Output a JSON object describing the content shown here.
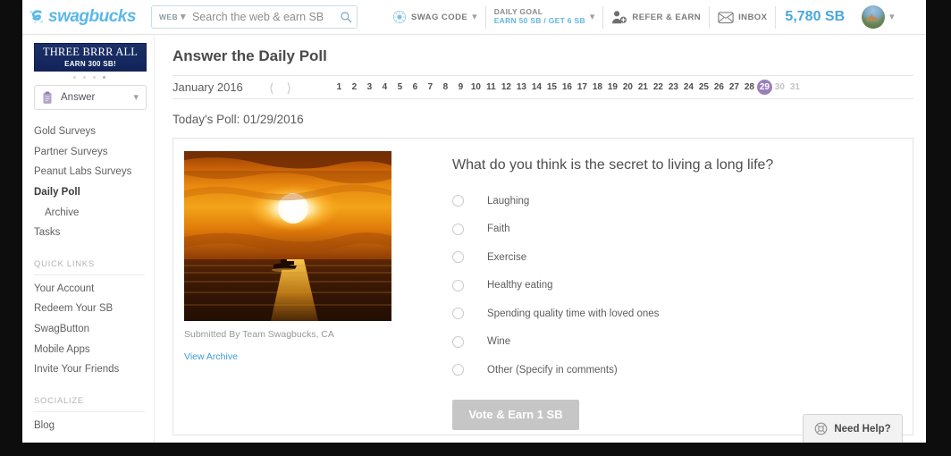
{
  "header": {
    "logo_text": "swagbucks",
    "logo_icon": "swagbucks-snowflake-logo",
    "search": {
      "vertical_label": "WEB",
      "placeholder": "Search the web & earn SB",
      "value": "",
      "icon": "search-icon"
    },
    "swag_code": {
      "label": "SWAG CODE",
      "icon": "swag-code-icon"
    },
    "daily_goal": {
      "line1": "DAILY GOAL",
      "line2": "EARN 50 SB / GET 6 SB"
    },
    "refer": {
      "label": "REFER & EARN",
      "icon": "add-user-icon"
    },
    "inbox": {
      "label": "INBOX",
      "icon": "envelope-icon"
    },
    "sb_balance": "5,780 SB",
    "avatar_icon": "user-avatar-horse"
  },
  "sidebar": {
    "promo": {
      "line1": "THREE BRRR ALL",
      "line2": "EARN 300 SB!",
      "dots": 4,
      "active_dot": 3
    },
    "answer_button": {
      "label": "Answer",
      "icon": "clipboard-icon"
    },
    "nav": [
      {
        "label": "Gold Surveys",
        "active": false,
        "sub": false
      },
      {
        "label": "Partner Surveys",
        "active": false,
        "sub": false
      },
      {
        "label": "Peanut Labs Surveys",
        "active": false,
        "sub": false
      },
      {
        "label": "Daily Poll",
        "active": true,
        "sub": false
      },
      {
        "label": "Archive",
        "active": false,
        "sub": true
      },
      {
        "label": "Tasks",
        "active": false,
        "sub": false
      }
    ],
    "quick_links_heading": "QUICK LINKS",
    "quick_links": [
      {
        "label": "Your Account"
      },
      {
        "label": "Redeem Your SB"
      },
      {
        "label": "SwagButton"
      },
      {
        "label": "Mobile Apps"
      },
      {
        "label": "Invite Your Friends"
      }
    ],
    "socialize_heading": "SOCIALIZE",
    "socialize": [
      {
        "label": "Blog"
      }
    ]
  },
  "main": {
    "page_title": "Answer the Daily Poll",
    "calendar": {
      "month": "January 2016",
      "prev_icon": "chevron-left-icon",
      "next_icon": "chevron-right-icon",
      "days": [
        {
          "n": "1"
        },
        {
          "n": "2"
        },
        {
          "n": "3"
        },
        {
          "n": "4"
        },
        {
          "n": "5"
        },
        {
          "n": "6"
        },
        {
          "n": "7"
        },
        {
          "n": "8"
        },
        {
          "n": "9"
        },
        {
          "n": "10"
        },
        {
          "n": "11"
        },
        {
          "n": "12"
        },
        {
          "n": "13"
        },
        {
          "n": "14"
        },
        {
          "n": "15"
        },
        {
          "n": "16"
        },
        {
          "n": "17"
        },
        {
          "n": "18"
        },
        {
          "n": "19"
        },
        {
          "n": "20"
        },
        {
          "n": "21"
        },
        {
          "n": "22"
        },
        {
          "n": "23"
        },
        {
          "n": "24"
        },
        {
          "n": "25"
        },
        {
          "n": "26"
        },
        {
          "n": "27"
        },
        {
          "n": "28"
        },
        {
          "n": "29",
          "selected": true
        },
        {
          "n": "30",
          "disabled": true
        },
        {
          "n": "31",
          "disabled": true
        }
      ],
      "selected_color": "#9a7fbb"
    },
    "today_line": "Today's Poll: 01/29/2016",
    "poll": {
      "image_alt": "sunset-over-ocean-with-boat",
      "image_caption": "Submitted By Team Swagbucks, CA",
      "archive_link": "View Archive",
      "question": "What do you think is the secret to living a long life?",
      "options": [
        {
          "label": "Laughing",
          "selected": false
        },
        {
          "label": "Faith",
          "selected": false
        },
        {
          "label": "Exercise",
          "selected": false
        },
        {
          "label": "Healthy eating",
          "selected": false
        },
        {
          "label": "Spending quality time with loved ones",
          "selected": false
        },
        {
          "label": "Wine",
          "selected": false
        },
        {
          "label": "Other (Specify in comments)",
          "selected": false
        }
      ],
      "vote_button": "Vote & Earn 1 SB"
    }
  },
  "need_help": {
    "label": "Need Help?",
    "icon": "lifebuoy-icon"
  }
}
